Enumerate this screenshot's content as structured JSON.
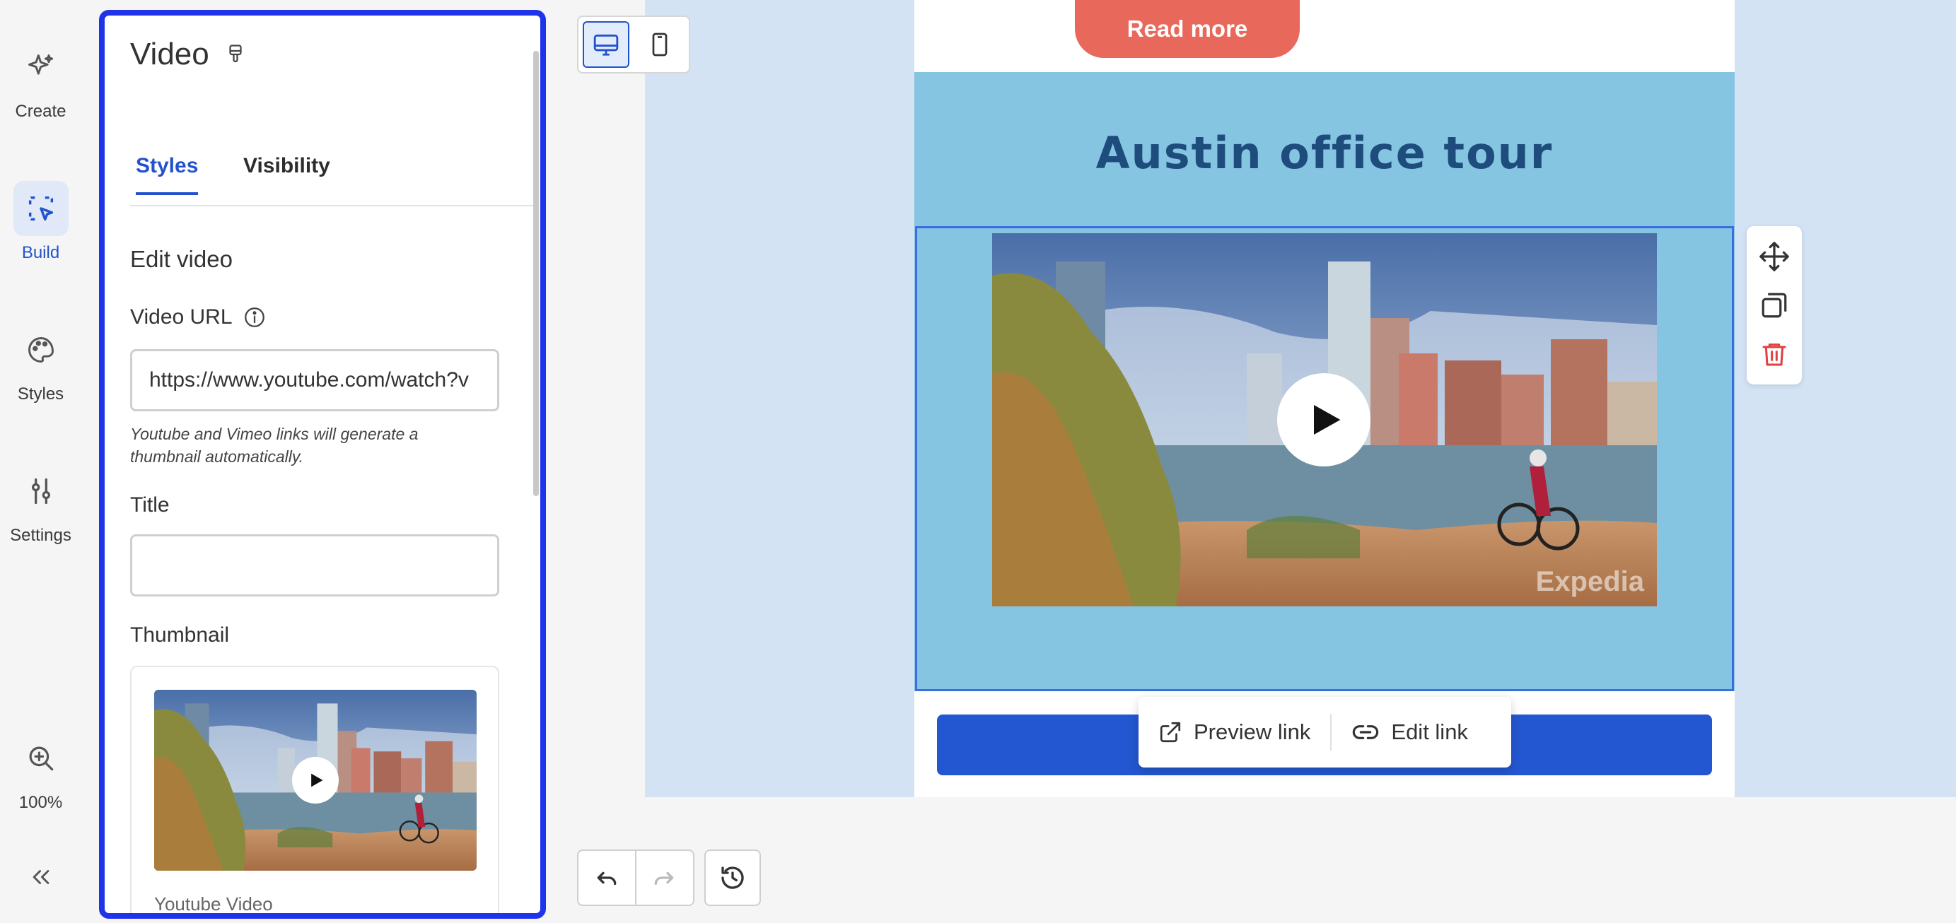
{
  "rail": {
    "create_label": "Create",
    "build_label": "Build",
    "styles_label": "Styles",
    "settings_label": "Settings",
    "zoom_label": "100%"
  },
  "panel": {
    "title": "Video",
    "tabs": [
      {
        "label": "Styles",
        "active": true
      },
      {
        "label": "Visibility",
        "active": false
      }
    ],
    "section_title": "Edit video",
    "video_url_label": "Video URL",
    "video_url_value": "https://www.youtube.com/watch?v",
    "hint": "Youtube and Vimeo links will generate a thumbnail automatically.",
    "title_label": "Title",
    "title_value": "",
    "thumbnail_label": "Thumbnail",
    "thumbnail_caption": "Youtube Video"
  },
  "canvas": {
    "read_more_label": "Read more",
    "heading": "Austin office tour",
    "watermark": "Expedia",
    "preview_link_label": "Preview link",
    "edit_link_label": "Edit link"
  },
  "colors": {
    "accent": "#2452cc",
    "selection": "#1f33e8",
    "section_bg": "#85c5e2",
    "heading": "#1e4d7d",
    "read_more": "#e8695c",
    "delete": "#e04040"
  }
}
